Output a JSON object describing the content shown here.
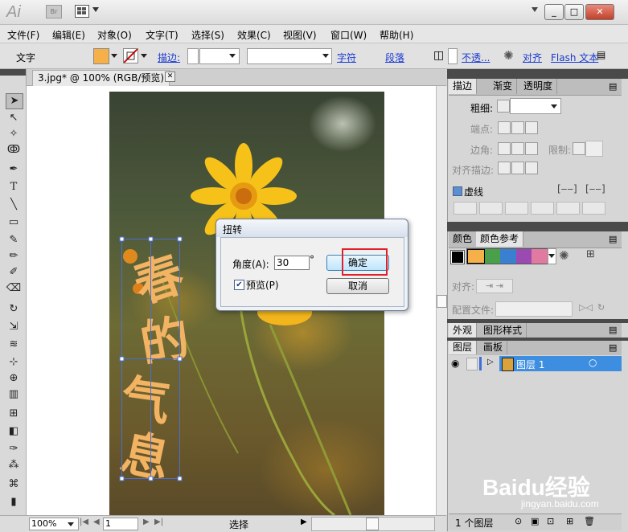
{
  "app": {
    "logo": "Ai",
    "bridge": "Br"
  },
  "window_controls": {
    "minimize": "_",
    "restore": "□",
    "close": "✕"
  },
  "menu": [
    "文件(F)",
    "编辑(E)",
    "对象(O)",
    "文字(T)",
    "选择(S)",
    "效果(C)",
    "视图(V)",
    "窗口(W)",
    "帮助(H)"
  ],
  "control_bar": {
    "type_label": "文字",
    "fill_color": "#f5b04a",
    "stroke_label": "描边:",
    "char_link": "字符",
    "para_link": "段落",
    "opacity_label": "不透...",
    "align_label": "对齐",
    "flash_text": "Flash 文本"
  },
  "document": {
    "tab_title": "3.jpg* @ 100% (RGB/预览)",
    "close": "✕"
  },
  "canvas_text": [
    "春",
    "的",
    "气",
    "息"
  ],
  "dialog": {
    "title": "扭转",
    "angle_label": "角度(A):",
    "angle_value": "30",
    "degree": "°",
    "preview_label": "预览(P)",
    "preview_checked": true,
    "ok": "确定",
    "cancel": "取消"
  },
  "stroke_panel": {
    "tabs": [
      "描边",
      "渐变",
      "透明度"
    ],
    "weight_label": "粗细:",
    "cap_label": "端点:",
    "corner_label": "边角:",
    "limit_label": "限制:",
    "align_stroke_label": "对齐描边:",
    "dashed_label": "虚线"
  },
  "color_panel": {
    "tabs": [
      "颜色",
      "颜色参考"
    ],
    "swatches": [
      "#f5b04a",
      "#4aa04a",
      "#3a7fd0",
      "#9a4ab0",
      "#e07aa0"
    ],
    "align_label": "对齐:",
    "profile_label": "配置文件:"
  },
  "appearance_panel": {
    "tabs": [
      "外观",
      "图形样式"
    ]
  },
  "layers_panel": {
    "tabs": [
      "图层",
      "画板"
    ],
    "layer_name": "图层 1",
    "footer": "1 个图层"
  },
  "status": {
    "zoom": "100%",
    "page": "1",
    "tool": "选择"
  },
  "watermark": {
    "brand": "Baidu经验",
    "url": "jingyan.baidu.com"
  }
}
